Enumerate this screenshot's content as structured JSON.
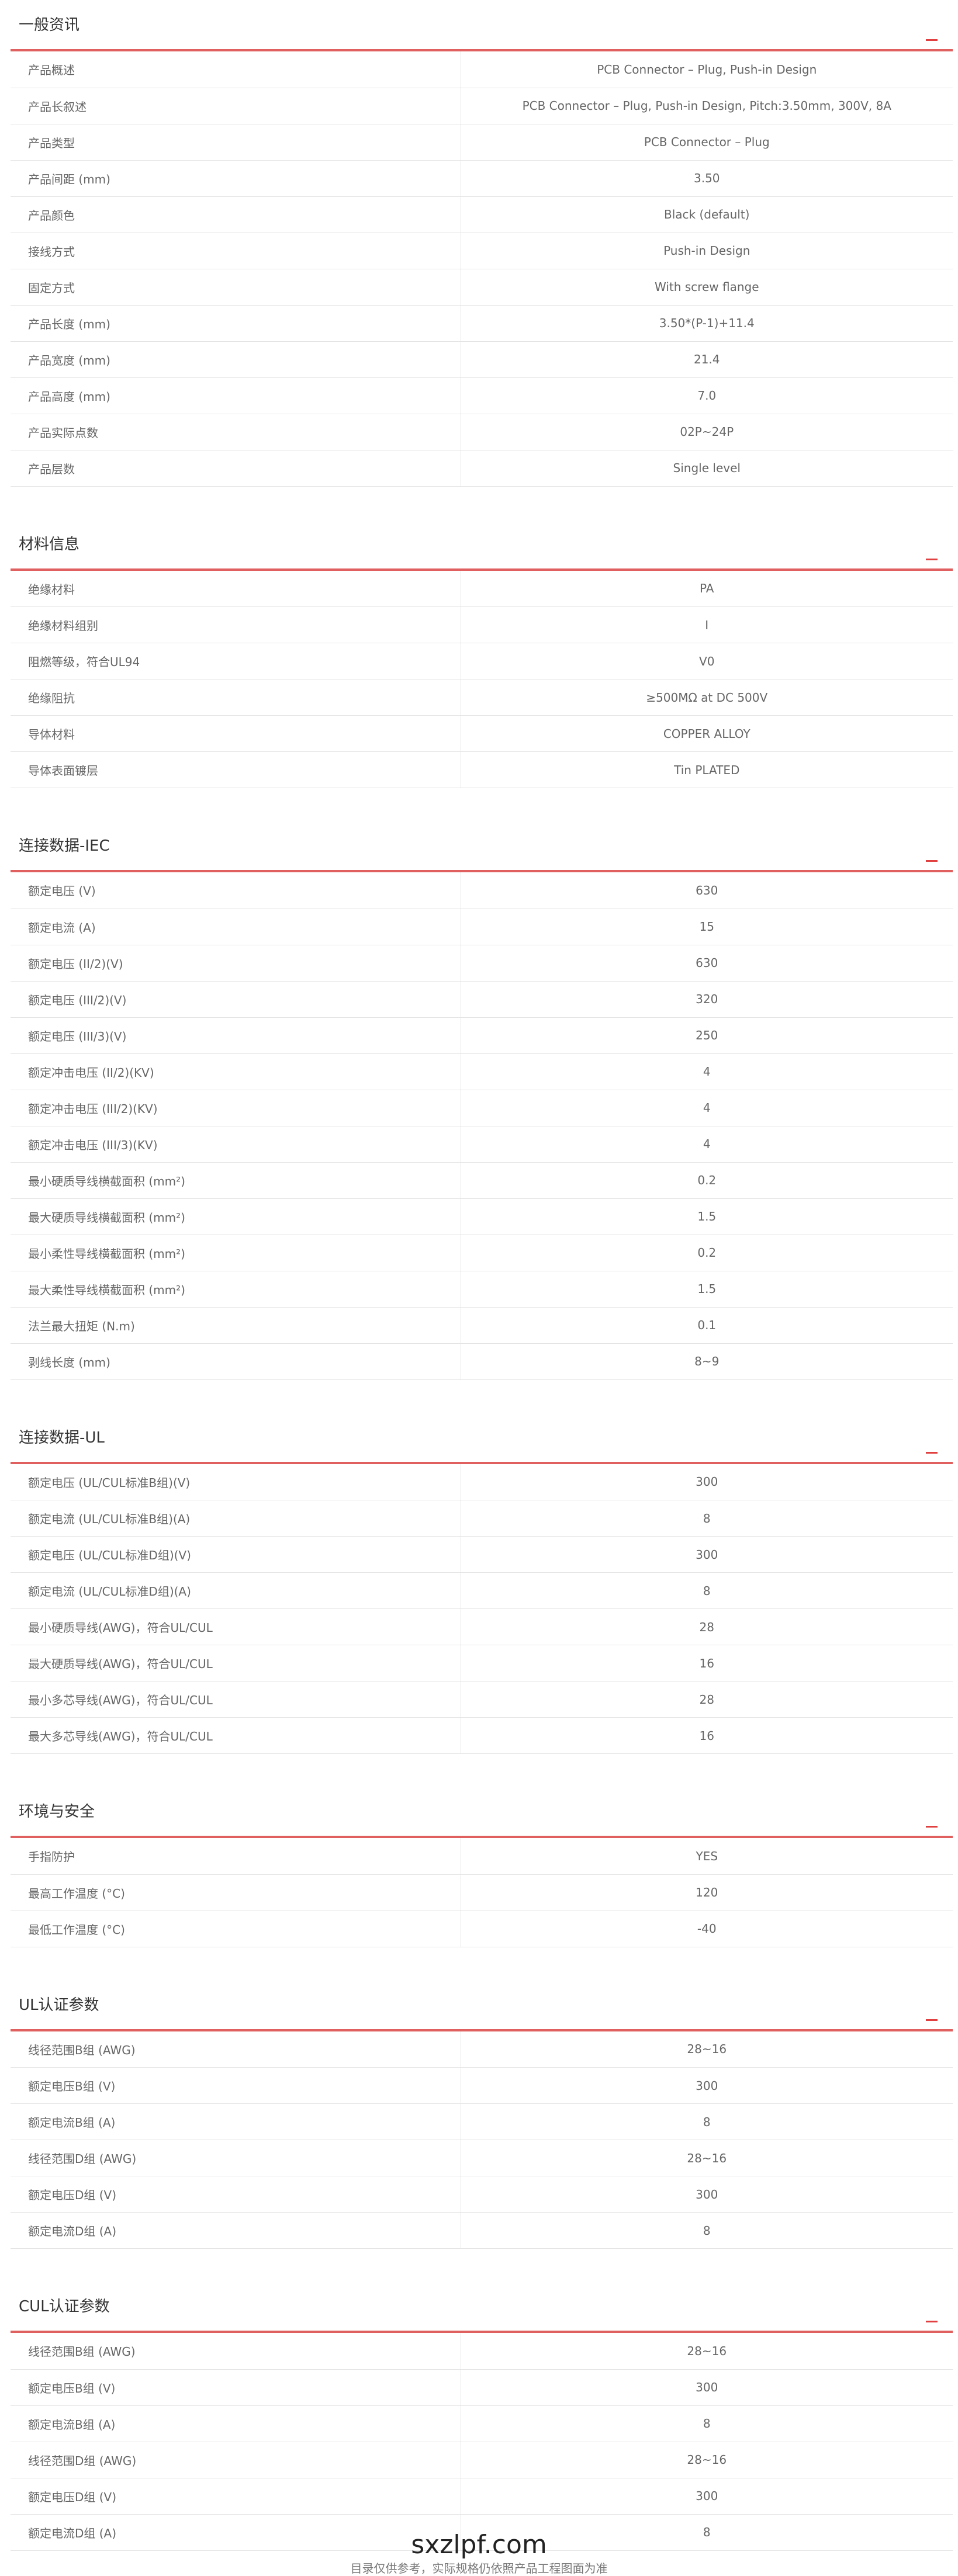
{
  "sections": [
    {
      "title": "一般资讯",
      "rows": [
        [
          "产品概述",
          "PCB Connector – Plug, Push-in Design"
        ],
        [
          "产品长叙述",
          "PCB Connector – Plug, Push-in Design, Pitch:3.50mm, 300V, 8A"
        ],
        [
          "产品类型",
          "PCB Connector – Plug"
        ],
        [
          "产品间距 (mm)",
          "3.50"
        ],
        [
          "产品颜色",
          "Black (default)"
        ],
        [
          "接线方式",
          "Push-in Design"
        ],
        [
          "固定方式",
          "With screw flange"
        ],
        [
          "产品长度 (mm)",
          "3.50*(P-1)+11.4"
        ],
        [
          "产品宽度 (mm)",
          "21.4"
        ],
        [
          "产品高度 (mm)",
          "7.0"
        ],
        [
          "产品实际点数",
          "02P~24P"
        ],
        [
          "产品层数",
          "Single level"
        ]
      ]
    },
    {
      "title": "材料信息",
      "rows": [
        [
          "绝缘材料",
          "PA"
        ],
        [
          "绝缘材料组别",
          "I"
        ],
        [
          "阻燃等级，符合UL94",
          "V0"
        ],
        [
          "绝缘阻抗",
          "≥500MΩ at DC 500V"
        ],
        [
          "导体材料",
          "COPPER ALLOY"
        ],
        [
          "导体表面镀层",
          "Tin PLATED"
        ]
      ]
    },
    {
      "title": "连接数据-IEC",
      "rows": [
        [
          "额定电压 (V)",
          "630"
        ],
        [
          "额定电流 (A)",
          "15"
        ],
        [
          "额定电压 (II/2)(V)",
          "630"
        ],
        [
          "额定电压 (III/2)(V)",
          "320"
        ],
        [
          "额定电压 (III/3)(V)",
          "250"
        ],
        [
          "额定冲击电压 (II/2)(KV)",
          "4"
        ],
        [
          "额定冲击电压 (III/2)(KV)",
          "4"
        ],
        [
          "额定冲击电压 (III/3)(KV)",
          "4"
        ],
        [
          "最小硬质导线横截面积 (mm²)",
          "0.2"
        ],
        [
          "最大硬质导线横截面积 (mm²)",
          "1.5"
        ],
        [
          "最小柔性导线横截面积 (mm²)",
          "0.2"
        ],
        [
          "最大柔性导线横截面积 (mm²)",
          "1.5"
        ],
        [
          "法兰最大扭矩 (N.m)",
          "0.1"
        ],
        [
          "剥线长度 (mm)",
          "8~9"
        ]
      ]
    },
    {
      "title": "连接数据-UL",
      "rows": [
        [
          "额定电压 (UL/CUL标准B组)(V)",
          "300"
        ],
        [
          "额定电流 (UL/CUL标准B组)(A)",
          "8"
        ],
        [
          "额定电压 (UL/CUL标准D组)(V)",
          "300"
        ],
        [
          "额定电流 (UL/CUL标准D组)(A)",
          "8"
        ],
        [
          "最小硬质导线(AWG)，符合UL/CUL",
          "28"
        ],
        [
          "最大硬质导线(AWG)，符合UL/CUL",
          "16"
        ],
        [
          "最小多芯导线(AWG)，符合UL/CUL",
          "28"
        ],
        [
          "最大多芯导线(AWG)，符合UL/CUL",
          "16"
        ]
      ]
    },
    {
      "title": "环境与安全",
      "rows": [
        [
          "手指防护",
          "YES"
        ],
        [
          "最高工作温度 (°C)",
          "120"
        ],
        [
          "最低工作温度 (°C)",
          "-40"
        ]
      ]
    },
    {
      "title": "UL认证参数",
      "rows": [
        [
          "线径范围B组 (AWG)",
          "28~16"
        ],
        [
          "额定电压B组 (V)",
          "300"
        ],
        [
          "额定电流B组 (A)",
          "8"
        ],
        [
          "线径范围D组 (AWG)",
          "28~16"
        ],
        [
          "额定电压D组 (V)",
          "300"
        ],
        [
          "额定电流D组 (A)",
          "8"
        ]
      ]
    },
    {
      "title": "CUL认证参数",
      "rows": [
        [
          "线径范围B组 (AWG)",
          "28~16"
        ],
        [
          "额定电压B组 (V)",
          "300"
        ],
        [
          "额定电流B组 (A)",
          "8"
        ],
        [
          "线径范围D组 (AWG)",
          "28~16"
        ],
        [
          "额定电压D组 (V)",
          "300"
        ],
        [
          "额定电流D组 (A)",
          "8"
        ]
      ]
    }
  ],
  "footer": {
    "site": "sxzlpf.com",
    "note": "目录仅供参考，实际规格仍依照产品工程图面为准"
  },
  "colors": {
    "accent": "#e06060",
    "toggle": "#e04040"
  }
}
